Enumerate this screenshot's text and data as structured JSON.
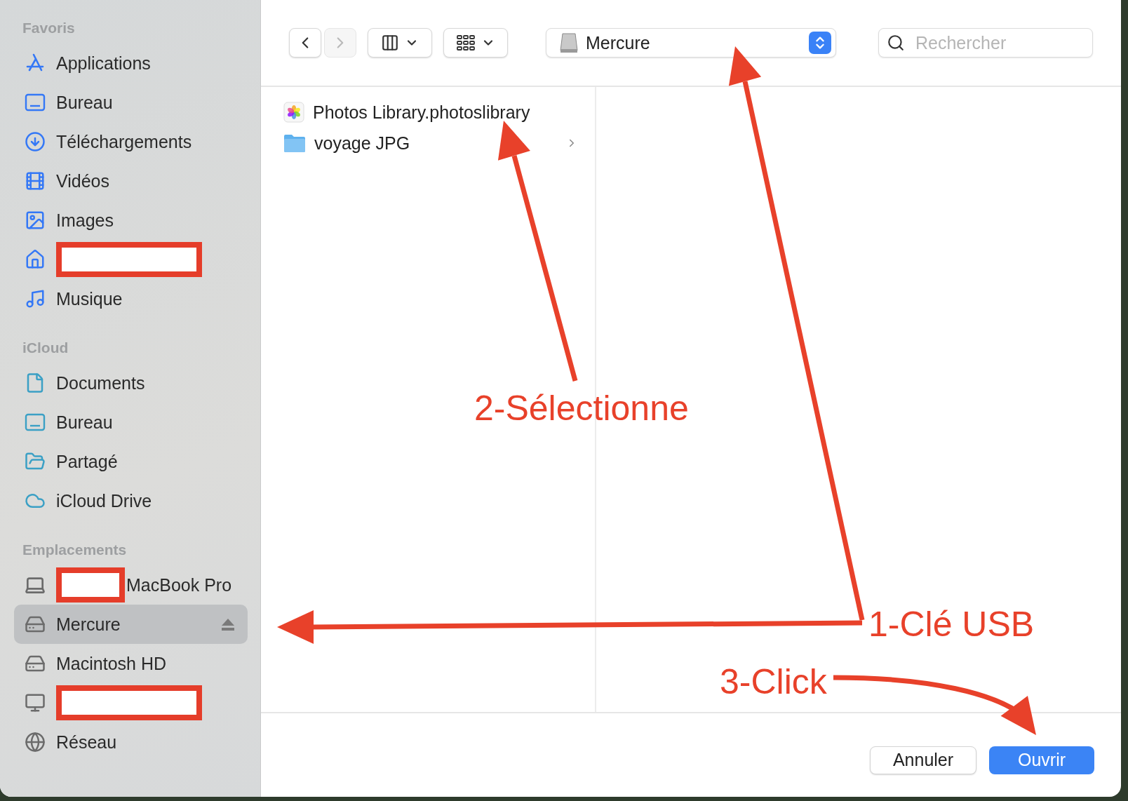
{
  "sidebar": {
    "sections": [
      {
        "title": "Favoris",
        "items": [
          {
            "label": "Applications",
            "selected": false
          },
          {
            "label": "Bureau",
            "selected": false
          },
          {
            "label": "Téléchargements",
            "selected": false
          },
          {
            "label": "Vidéos",
            "selected": false
          },
          {
            "label": "Images",
            "selected": false
          },
          {
            "redacted": true,
            "selected": false
          },
          {
            "label": "Musique",
            "selected": false
          }
        ]
      },
      {
        "title": "iCloud",
        "items": [
          {
            "label": "Documents",
            "selected": false
          },
          {
            "label": "Bureau",
            "selected": false
          },
          {
            "label": "Partagé",
            "selected": false
          },
          {
            "label": "iCloud Drive",
            "selected": false
          }
        ]
      },
      {
        "title": "Emplacements",
        "items": [
          {
            "label": "MacBook Pro",
            "redacted": true,
            "selected": false
          },
          {
            "label": "Mercure",
            "selected": true,
            "ejectable": true
          },
          {
            "label": "Macintosh HD",
            "selected": false
          },
          {
            "redacted": true,
            "selected": false
          },
          {
            "label": "Réseau",
            "selected": false
          }
        ]
      }
    ]
  },
  "toolbar": {
    "navigation": [
      {
        "disabled": false
      },
      {
        "disabled": true
      }
    ],
    "location": {
      "label": "Mercure"
    },
    "search": {
      "placeholder": "Rechercher"
    }
  },
  "files": [
    {
      "name": "Photos Library.photoslibrary",
      "kind": "library",
      "selected": false,
      "expandable": false
    },
    {
      "name": "voyage JPG",
      "kind": "folder",
      "selected": false,
      "expandable": true
    }
  ],
  "buttons": [
    {
      "label": "Annuler",
      "kind": "secondary"
    },
    {
      "label": "Ouvrir",
      "kind": "primary"
    }
  ],
  "annotations": [
    {
      "text": "2-Sélectionne"
    },
    {
      "text": "1-Clé USB"
    },
    {
      "text": "3-Click"
    }
  ]
}
